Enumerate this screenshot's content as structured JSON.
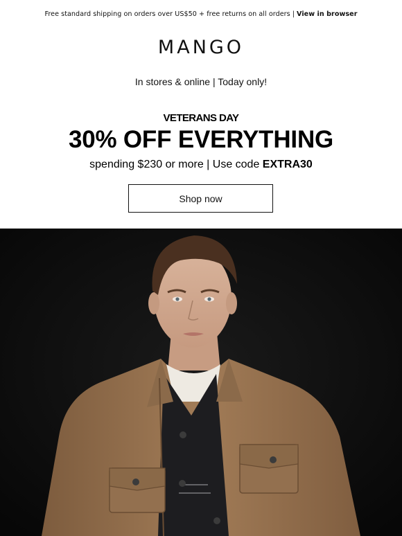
{
  "topbar": {
    "shipping_text": "Free standard shipping on orders over US$50 + free returns on all orders",
    "separator": "|",
    "view_in_browser": "View in browser"
  },
  "brand": {
    "logo_text": "MANGO"
  },
  "promo": {
    "stores_line": "In stores & online | Today only!",
    "eyebrow": "VETERANS DAY",
    "headline": "30% OFF EVERYTHING",
    "spending_prefix": "spending $230 or more | Use code ",
    "code": "EXTRA30",
    "cta_label": "Shop now"
  },
  "hero": {
    "image": "model-in-camel-overshirt-photo"
  },
  "colors": {
    "background": "#ffffff",
    "text": "#000000",
    "hero_background": "#0c0c0c",
    "jacket": "#9a7450"
  }
}
